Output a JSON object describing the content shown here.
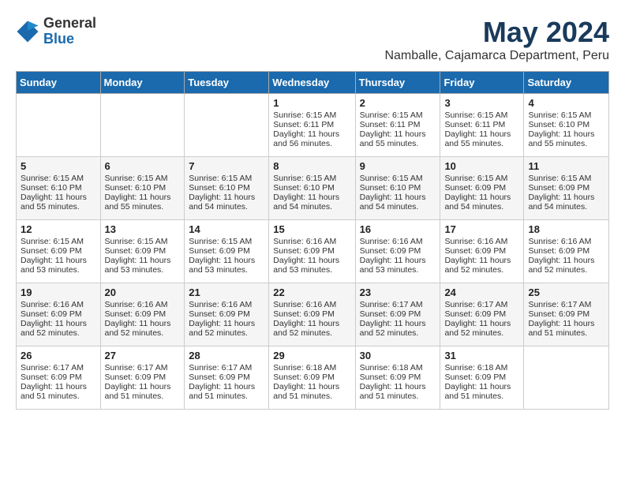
{
  "header": {
    "logo_general": "General",
    "logo_blue": "Blue",
    "month": "May 2024",
    "location": "Namballe, Cajamarca Department, Peru"
  },
  "weekdays": [
    "Sunday",
    "Monday",
    "Tuesday",
    "Wednesday",
    "Thursday",
    "Friday",
    "Saturday"
  ],
  "weeks": [
    [
      {
        "day": "",
        "sunrise": "",
        "sunset": "",
        "daylight": ""
      },
      {
        "day": "",
        "sunrise": "",
        "sunset": "",
        "daylight": ""
      },
      {
        "day": "",
        "sunrise": "",
        "sunset": "",
        "daylight": ""
      },
      {
        "day": "1",
        "sunrise": "Sunrise: 6:15 AM",
        "sunset": "Sunset: 6:11 PM",
        "daylight": "Daylight: 11 hours and 56 minutes."
      },
      {
        "day": "2",
        "sunrise": "Sunrise: 6:15 AM",
        "sunset": "Sunset: 6:11 PM",
        "daylight": "Daylight: 11 hours and 55 minutes."
      },
      {
        "day": "3",
        "sunrise": "Sunrise: 6:15 AM",
        "sunset": "Sunset: 6:11 PM",
        "daylight": "Daylight: 11 hours and 55 minutes."
      },
      {
        "day": "4",
        "sunrise": "Sunrise: 6:15 AM",
        "sunset": "Sunset: 6:10 PM",
        "daylight": "Daylight: 11 hours and 55 minutes."
      }
    ],
    [
      {
        "day": "5",
        "sunrise": "Sunrise: 6:15 AM",
        "sunset": "Sunset: 6:10 PM",
        "daylight": "Daylight: 11 hours and 55 minutes."
      },
      {
        "day": "6",
        "sunrise": "Sunrise: 6:15 AM",
        "sunset": "Sunset: 6:10 PM",
        "daylight": "Daylight: 11 hours and 55 minutes."
      },
      {
        "day": "7",
        "sunrise": "Sunrise: 6:15 AM",
        "sunset": "Sunset: 6:10 PM",
        "daylight": "Daylight: 11 hours and 54 minutes."
      },
      {
        "day": "8",
        "sunrise": "Sunrise: 6:15 AM",
        "sunset": "Sunset: 6:10 PM",
        "daylight": "Daylight: 11 hours and 54 minutes."
      },
      {
        "day": "9",
        "sunrise": "Sunrise: 6:15 AM",
        "sunset": "Sunset: 6:10 PM",
        "daylight": "Daylight: 11 hours and 54 minutes."
      },
      {
        "day": "10",
        "sunrise": "Sunrise: 6:15 AM",
        "sunset": "Sunset: 6:09 PM",
        "daylight": "Daylight: 11 hours and 54 minutes."
      },
      {
        "day": "11",
        "sunrise": "Sunrise: 6:15 AM",
        "sunset": "Sunset: 6:09 PM",
        "daylight": "Daylight: 11 hours and 54 minutes."
      }
    ],
    [
      {
        "day": "12",
        "sunrise": "Sunrise: 6:15 AM",
        "sunset": "Sunset: 6:09 PM",
        "daylight": "Daylight: 11 hours and 53 minutes."
      },
      {
        "day": "13",
        "sunrise": "Sunrise: 6:15 AM",
        "sunset": "Sunset: 6:09 PM",
        "daylight": "Daylight: 11 hours and 53 minutes."
      },
      {
        "day": "14",
        "sunrise": "Sunrise: 6:15 AM",
        "sunset": "Sunset: 6:09 PM",
        "daylight": "Daylight: 11 hours and 53 minutes."
      },
      {
        "day": "15",
        "sunrise": "Sunrise: 6:16 AM",
        "sunset": "Sunset: 6:09 PM",
        "daylight": "Daylight: 11 hours and 53 minutes."
      },
      {
        "day": "16",
        "sunrise": "Sunrise: 6:16 AM",
        "sunset": "Sunset: 6:09 PM",
        "daylight": "Daylight: 11 hours and 53 minutes."
      },
      {
        "day": "17",
        "sunrise": "Sunrise: 6:16 AM",
        "sunset": "Sunset: 6:09 PM",
        "daylight": "Daylight: 11 hours and 52 minutes."
      },
      {
        "day": "18",
        "sunrise": "Sunrise: 6:16 AM",
        "sunset": "Sunset: 6:09 PM",
        "daylight": "Daylight: 11 hours and 52 minutes."
      }
    ],
    [
      {
        "day": "19",
        "sunrise": "Sunrise: 6:16 AM",
        "sunset": "Sunset: 6:09 PM",
        "daylight": "Daylight: 11 hours and 52 minutes."
      },
      {
        "day": "20",
        "sunrise": "Sunrise: 6:16 AM",
        "sunset": "Sunset: 6:09 PM",
        "daylight": "Daylight: 11 hours and 52 minutes."
      },
      {
        "day": "21",
        "sunrise": "Sunrise: 6:16 AM",
        "sunset": "Sunset: 6:09 PM",
        "daylight": "Daylight: 11 hours and 52 minutes."
      },
      {
        "day": "22",
        "sunrise": "Sunrise: 6:16 AM",
        "sunset": "Sunset: 6:09 PM",
        "daylight": "Daylight: 11 hours and 52 minutes."
      },
      {
        "day": "23",
        "sunrise": "Sunrise: 6:17 AM",
        "sunset": "Sunset: 6:09 PM",
        "daylight": "Daylight: 11 hours and 52 minutes."
      },
      {
        "day": "24",
        "sunrise": "Sunrise: 6:17 AM",
        "sunset": "Sunset: 6:09 PM",
        "daylight": "Daylight: 11 hours and 52 minutes."
      },
      {
        "day": "25",
        "sunrise": "Sunrise: 6:17 AM",
        "sunset": "Sunset: 6:09 PM",
        "daylight": "Daylight: 11 hours and 51 minutes."
      }
    ],
    [
      {
        "day": "26",
        "sunrise": "Sunrise: 6:17 AM",
        "sunset": "Sunset: 6:09 PM",
        "daylight": "Daylight: 11 hours and 51 minutes."
      },
      {
        "day": "27",
        "sunrise": "Sunrise: 6:17 AM",
        "sunset": "Sunset: 6:09 PM",
        "daylight": "Daylight: 11 hours and 51 minutes."
      },
      {
        "day": "28",
        "sunrise": "Sunrise: 6:17 AM",
        "sunset": "Sunset: 6:09 PM",
        "daylight": "Daylight: 11 hours and 51 minutes."
      },
      {
        "day": "29",
        "sunrise": "Sunrise: 6:18 AM",
        "sunset": "Sunset: 6:09 PM",
        "daylight": "Daylight: 11 hours and 51 minutes."
      },
      {
        "day": "30",
        "sunrise": "Sunrise: 6:18 AM",
        "sunset": "Sunset: 6:09 PM",
        "daylight": "Daylight: 11 hours and 51 minutes."
      },
      {
        "day": "31",
        "sunrise": "Sunrise: 6:18 AM",
        "sunset": "Sunset: 6:09 PM",
        "daylight": "Daylight: 11 hours and 51 minutes."
      },
      {
        "day": "",
        "sunrise": "",
        "sunset": "",
        "daylight": ""
      }
    ]
  ]
}
